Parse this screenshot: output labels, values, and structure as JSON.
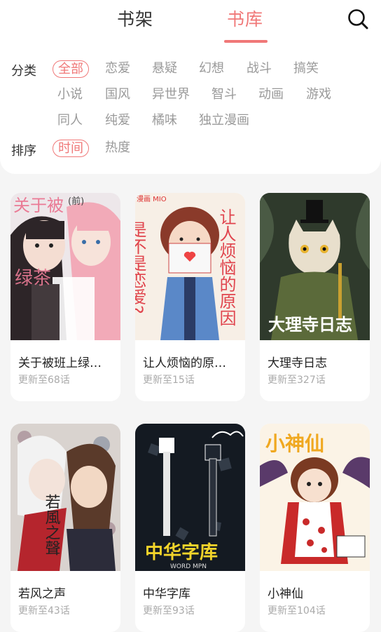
{
  "tabs": [
    {
      "label": "书架"
    },
    {
      "label": "书库"
    }
  ],
  "filters": {
    "category_label": "分类",
    "categories": [
      "全部",
      "恋爱",
      "悬疑",
      "幻想",
      "战斗",
      "搞笑",
      "小说",
      "国风",
      "异世界",
      "智斗",
      "动画",
      "游戏",
      "同人",
      "纯爱",
      "橘味",
      "独立漫画"
    ],
    "sort_label": "排序",
    "sorts": [
      "时间",
      "热度"
    ]
  },
  "books": [
    {
      "title": "关于被班上绿…",
      "update": "更新至68话"
    },
    {
      "title": "让人烦恼的原…",
      "update": "更新至15话"
    },
    {
      "title": "大理寺日志",
      "update": "更新至327话"
    },
    {
      "title": "若风之声",
      "update": "更新至43话"
    },
    {
      "title": "中华字库",
      "update": "更新至93话"
    },
    {
      "title": "小神仙",
      "update": "更新至104话"
    }
  ],
  "cover_text": {
    "c1_top": "关于被",
    "c1_mid": "绿茶",
    "c1_small": "(前)",
    "c2_tag": "漫画 MIO",
    "c2_left": "是不是恋爱?",
    "c2_right": "让人烦恼的原因",
    "c3_title": "大理寺日志",
    "c4_title": "若風之聲",
    "c5_title": "中华字库",
    "c5_sub": "WORD MPN",
    "c6_title": "小神仙"
  },
  "colors": {
    "accent": "#f07878",
    "muted": "#9a9a9a",
    "background": "#f5f5f5"
  },
  "icons": {
    "search": "magnifier"
  }
}
